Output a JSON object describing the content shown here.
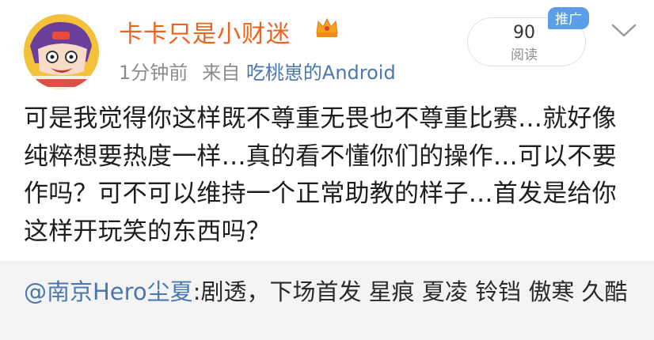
{
  "post": {
    "author": "卡卡只是小财迷",
    "time": "1分钟前",
    "source_prefix": "来自",
    "source_app": "吃桃崽的Android",
    "read_count": "90",
    "read_label": "阅读",
    "promo_badge": "推广",
    "body": "可是我觉得你这样既不尊重无畏也不尊重比赛…就好像纯粹想要热度一样…真的看不懂你们的操作…可以不要作吗？可不可以维持一个正常助教的样子…首发是给你这样开玩笑的东西吗？"
  },
  "repost": {
    "mention": "@南京Hero尘夏",
    "text": ":剧透，下场首发 星痕 夏凌 铃铛 傲寒 久酷"
  },
  "icons": {
    "avatar": "cartoon-avatar",
    "badge": "crown-icon",
    "menu": "chevron-down-icon"
  },
  "colors": {
    "username": "#f0611b",
    "link": "#4a77b0",
    "promo": "#5b9ee8",
    "repost_bg": "#f4f4f4"
  }
}
